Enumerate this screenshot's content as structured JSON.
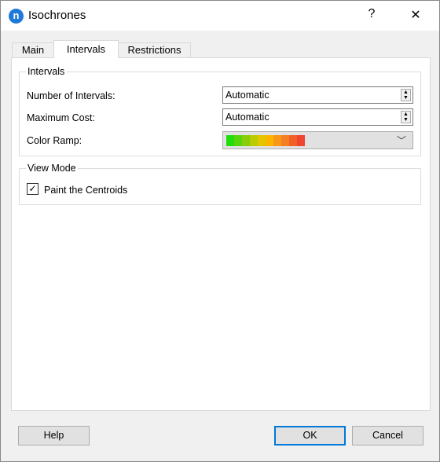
{
  "window": {
    "title": "Isochrones",
    "app_icon_letter": "n",
    "help_glyph": "?",
    "close_glyph": "✕"
  },
  "tabs": [
    {
      "label": "Main"
    },
    {
      "label": "Intervals",
      "active": true
    },
    {
      "label": "Restrictions"
    }
  ],
  "intervals_group": {
    "title": "Intervals",
    "number_label": "Number of Intervals:",
    "number_value": "Automatic",
    "cost_label": "Maximum Cost:",
    "cost_value": "Automatic",
    "ramp_label": "Color Ramp:",
    "ramp_colors": [
      "#22dd0a",
      "#55d50a",
      "#88cc0a",
      "#b8cc00",
      "#e5c400",
      "#fbb400",
      "#f8971a",
      "#f47f22",
      "#f06027",
      "#ef4430"
    ]
  },
  "view_mode_group": {
    "title": "View Mode",
    "paint_centroids_label": "Paint the Centroids",
    "paint_centroids_checked": true
  },
  "buttons": {
    "help": "Help",
    "ok": "OK",
    "cancel": "Cancel"
  }
}
